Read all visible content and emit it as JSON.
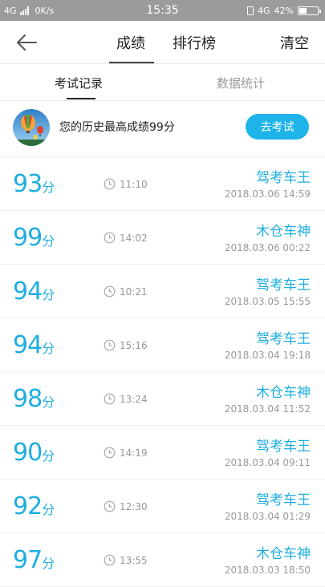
{
  "status_bar": {
    "network": "4G",
    "speed": "0K/s",
    "time": "15:35",
    "network_right": "4G",
    "battery": "42%",
    "battery_level": 0.42
  },
  "header": {
    "tabs": [
      {
        "label": "成绩",
        "active": true
      },
      {
        "label": "排行榜",
        "active": false
      }
    ],
    "clear_label": "清空"
  },
  "sub_tabs": [
    {
      "label": "考试记录",
      "active": true
    },
    {
      "label": "数据统计",
      "active": false
    }
  ],
  "best": {
    "text": "您的历史最高成绩99分",
    "button_label": "去考试"
  },
  "score_unit": "分",
  "records": [
    {
      "score": "93",
      "duration": "11:10",
      "title": "驾考车王",
      "date": "2018.03.06  14:59"
    },
    {
      "score": "99",
      "duration": "14:02",
      "title": "木仓车神",
      "date": "2018.03.06  00:22"
    },
    {
      "score": "94",
      "duration": "10:21",
      "title": "驾考车王",
      "date": "2018.03.05  15:55"
    },
    {
      "score": "94",
      "duration": "15:16",
      "title": "驾考车王",
      "date": "2018.03.04  19:18"
    },
    {
      "score": "98",
      "duration": "13:24",
      "title": "木仓车神",
      "date": "2018.03.04  11:52"
    },
    {
      "score": "90",
      "duration": "14:19",
      "title": "驾考车王",
      "date": "2018.03.04  09:11"
    },
    {
      "score": "92",
      "duration": "12:30",
      "title": "驾考车王",
      "date": "2018.03.04  01:29"
    },
    {
      "score": "97",
      "duration": "13:55",
      "title": "木仓车神",
      "date": "2018.03.03  18:50"
    }
  ],
  "colors": {
    "accent": "#1eb4ea",
    "status_bar": "#9b9b9b"
  }
}
